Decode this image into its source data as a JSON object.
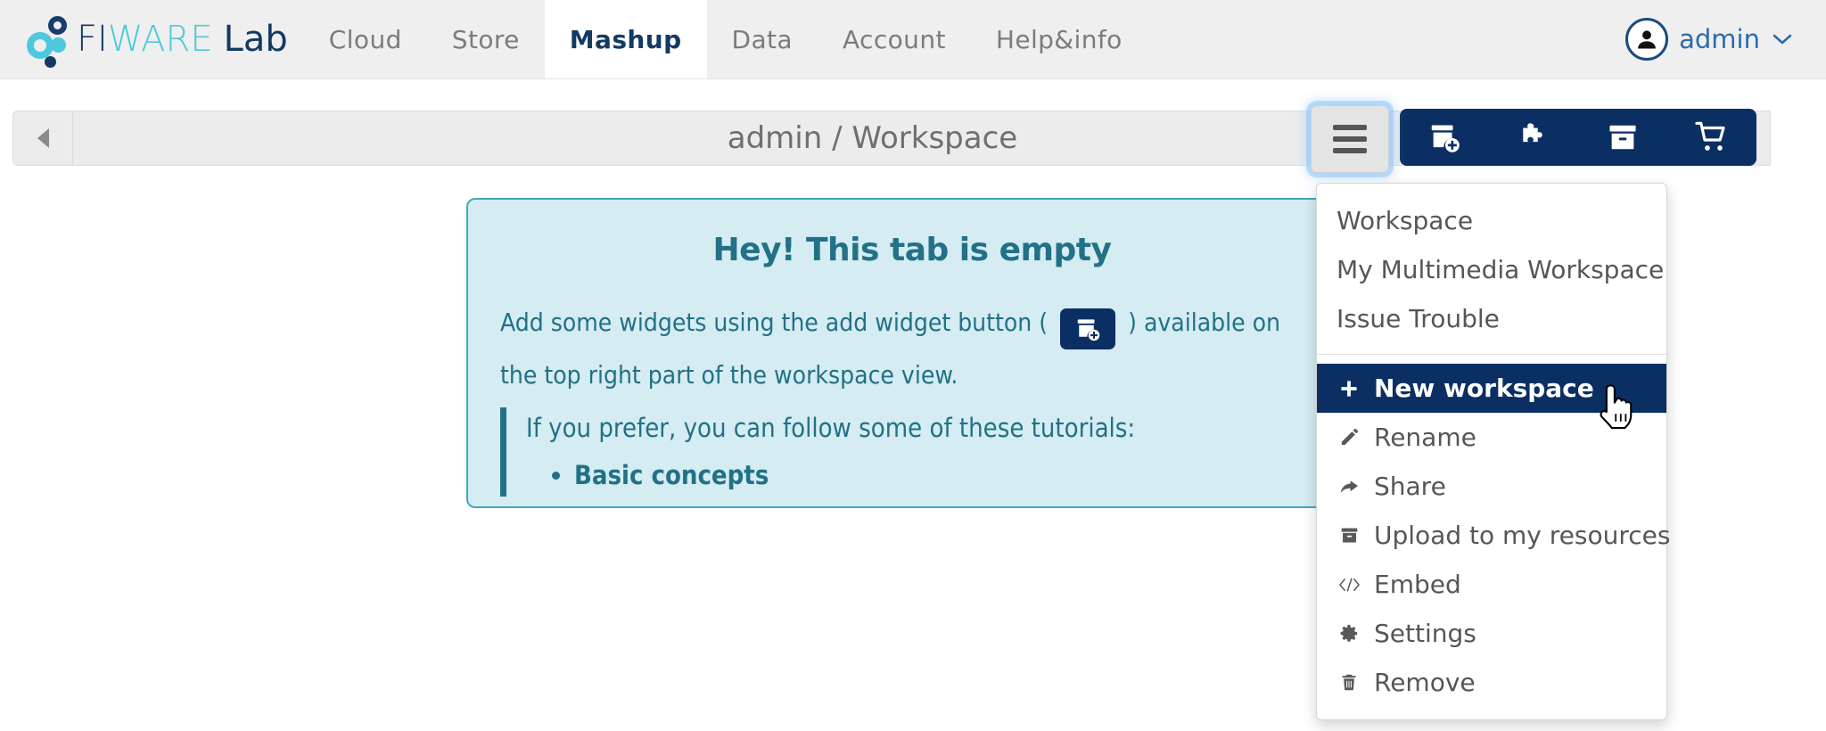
{
  "header": {
    "brand": {
      "fi": "FI",
      "ware": "WARE",
      "lab": "Lab",
      "logo_icon": "fiware-logo-icon"
    },
    "nav": [
      {
        "label": "Cloud",
        "active": false
      },
      {
        "label": "Store",
        "active": false
      },
      {
        "label": "Mashup",
        "active": true
      },
      {
        "label": "Data",
        "active": false
      },
      {
        "label": "Account",
        "active": false
      },
      {
        "label": "Help&info",
        "active": false
      }
    ],
    "user": {
      "name": "admin",
      "avatar_icon": "user-avatar-icon",
      "chevron": "⌄"
    }
  },
  "workspace_bar": {
    "back_icon": "back-arrow-icon",
    "title": "admin / Workspace",
    "menu_button_icon": "hamburger-menu-icon",
    "actions": [
      {
        "name": "add-widget-button",
        "icon": "add-widget-icon"
      },
      {
        "name": "wiring-button",
        "icon": "puzzle-piece-icon"
      },
      {
        "name": "my-resources-button",
        "icon": "archive-box-icon"
      },
      {
        "name": "marketplace-button",
        "icon": "shopping-cart-icon"
      }
    ]
  },
  "alert": {
    "title": "Hey! This tab is empty",
    "body_before": "Add some widgets using the add widget button (",
    "inline_button_icon": "add-widget-icon",
    "body_after": ") available on",
    "body_line2": "the top right part of the workspace view.",
    "quote_text": "If you prefer, you can follow some of these tutorials:",
    "tutorials": [
      "Basic concepts"
    ]
  },
  "dropdown": {
    "workspaces": [
      {
        "label": "Workspace"
      },
      {
        "label": "My Multimedia Workspace"
      },
      {
        "label": "Issue Trouble"
      }
    ],
    "actions": [
      {
        "label": "New workspace",
        "icon": "plus-icon",
        "highlight": true
      },
      {
        "label": "Rename",
        "icon": "pencil-icon",
        "highlight": false
      },
      {
        "label": "Share",
        "icon": "share-arrow-icon",
        "highlight": false
      },
      {
        "label": "Upload to my resources",
        "icon": "archive-box-icon",
        "highlight": false
      },
      {
        "label": "Embed",
        "icon": "code-brackets-icon",
        "highlight": false
      },
      {
        "label": "Settings",
        "icon": "gear-icon",
        "highlight": false
      },
      {
        "label": "Remove",
        "icon": "trash-icon",
        "highlight": false
      }
    ]
  },
  "colors": {
    "brand_dark": "#123a63",
    "brand_cyan": "#4ec8dc",
    "nav_active_text": "#123a63",
    "toolbar_navy": "#0b2f63",
    "alert_bg": "#d4ecf2",
    "alert_border": "#3fa9bf",
    "alert_text": "#227186",
    "user_link": "#2b6cab"
  }
}
